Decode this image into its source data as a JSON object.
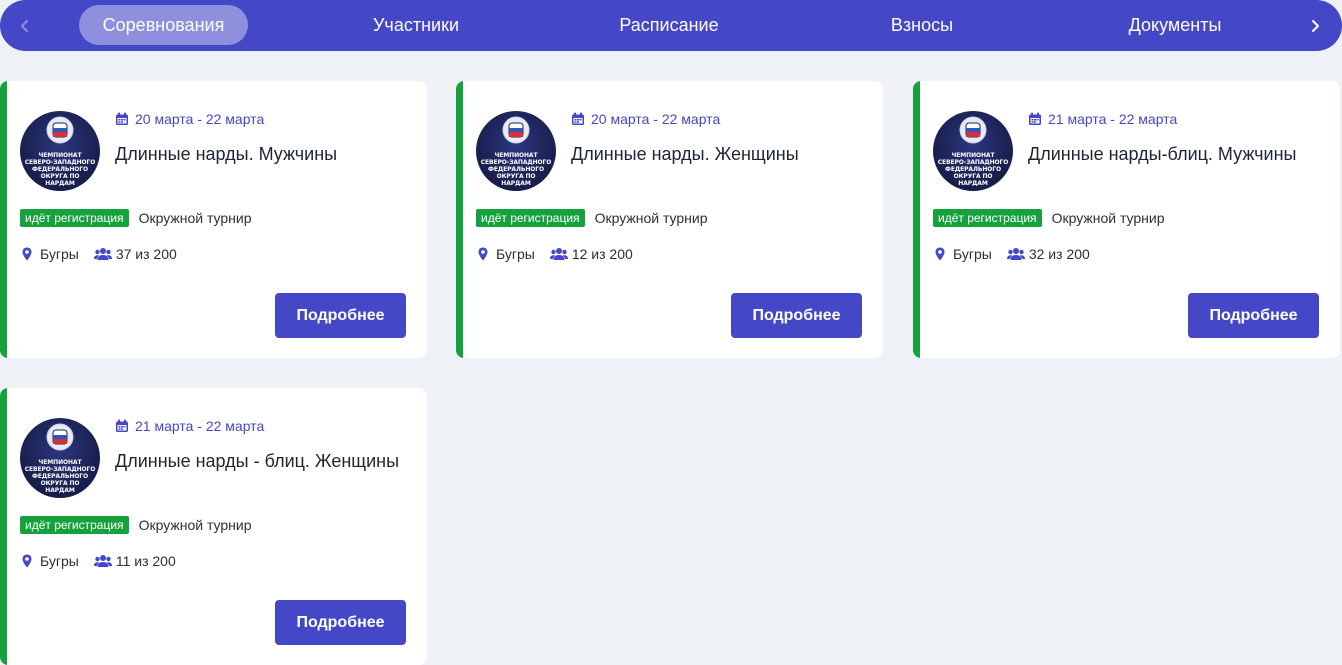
{
  "nav": {
    "tabs": [
      {
        "label": "Соревнования",
        "active": true
      },
      {
        "label": "Участники",
        "active": false
      },
      {
        "label": "Расписание",
        "active": false
      },
      {
        "label": "Взносы",
        "active": false
      },
      {
        "label": "Документы",
        "active": false
      }
    ],
    "prev_icon": "chevron-left-icon",
    "next_icon": "chevron-right-icon"
  },
  "logo_text": "ЧЕМПИОНАТ\nСЕВЕРО-ЗАПАДНОГО\nФЕДЕРАЛЬНОГО\nОКРУГА ПО\nНАРДАМ",
  "cards": [
    {
      "date": "20 марта - 22 марта",
      "title": "Длинные нарды. Мужчины",
      "status": "идёт регистрация",
      "type": "Окружной турнир",
      "city": "Бугры",
      "participants": "37 из 200",
      "button": "Подробнее"
    },
    {
      "date": "20 марта - 22 марта",
      "title": "Длинные нарды. Женщины",
      "status": "идёт регистрация",
      "type": "Окружной турнир",
      "city": "Бугры",
      "participants": "12 из 200",
      "button": "Подробнее"
    },
    {
      "date": "21 марта - 22 марта",
      "title": "Длинные нарды-блиц. Мужчины",
      "status": "идёт регистрация",
      "type": "Окружной турнир",
      "city": "Бугры",
      "participants": "32 из 200",
      "button": "Подробнее"
    },
    {
      "date": "21 марта - 22 марта",
      "title": "Длинные нарды - блиц. Женщины",
      "status": "идёт регистрация",
      "type": "Окружной турнир",
      "city": "Бугры",
      "participants": "11 из 200",
      "button": "Подробнее"
    }
  ],
  "colors": {
    "primary": "#4447c6",
    "active_tab": "#8e90dd",
    "accent_green": "#15a23d",
    "background": "#eef1f6"
  }
}
